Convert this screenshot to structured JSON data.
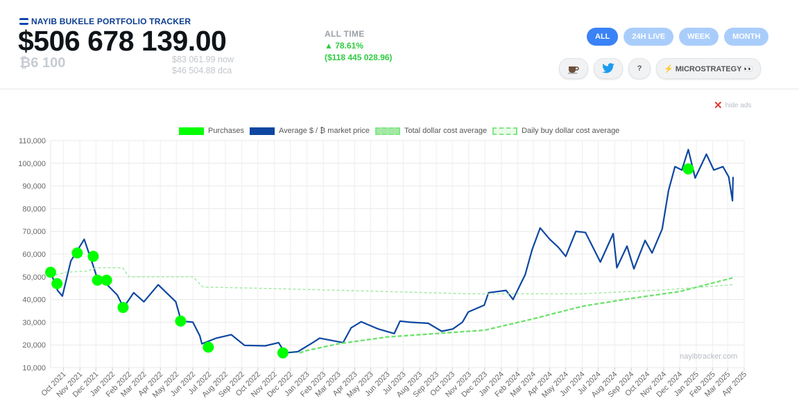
{
  "header": {
    "title": "NAYIB BUKELE PORTFOLIO TRACKER",
    "total_value": "$506 678 139.00",
    "btc_holdings": "₿6 100",
    "price_now": "$83 061.99",
    "price_now_suffix": "now",
    "price_dca": "$46 504.88",
    "price_dca_suffix": "dca",
    "all_time_label": "ALL TIME",
    "all_time_pct": "▲ 78.61%",
    "all_time_usd": "($118 445 028.96)"
  },
  "tabs": [
    {
      "label": "ALL",
      "active": true
    },
    {
      "label": "24H LIVE",
      "active": false
    },
    {
      "label": "WEEK",
      "active": false
    },
    {
      "label": "MONTH",
      "active": false
    }
  ],
  "buttons": {
    "coffee_icon": "coffee-icon",
    "twitter_icon": "twitter-icon",
    "help_label": "?",
    "microstrategy_label": "⚡ MICROSTRATEGY 👀"
  },
  "hide_ads": "hide ads",
  "watermark": "nayibtracker.com",
  "colors": {
    "accent": "#3b82f6",
    "accent_light": "#a9cdfb",
    "positive": "#2ecc40",
    "price_line": "#0d47a1",
    "purchases": "#00ff00",
    "dca_line": "#7ee787"
  },
  "chart_data": {
    "type": "line",
    "legend": [
      "Purchases",
      "Average $ / ₿ market price",
      "Total dollar cost average",
      "Daily buy dollar cost average"
    ],
    "legend_position": "top",
    "grid": true,
    "ylim": [
      10000,
      110000
    ],
    "y_ticks": [
      "10,000",
      "20,000",
      "30,000",
      "40,000",
      "50,000",
      "60,000",
      "70,000",
      "80,000",
      "90,000",
      "100,000",
      "110,000"
    ],
    "x_ticks": [
      "Oct 2021",
      "Nov 2021",
      "Dec 2021",
      "Jan 2022",
      "Feb 2022",
      "Mar 2022",
      "Apr 2022",
      "May 2022",
      "Jun 2022",
      "Jul 2022",
      "Aug 2022",
      "Sep 2022",
      "Oct 2022",
      "Nov 2022",
      "Dec 2022",
      "Jan 2023",
      "Feb 2023",
      "Mar 2023",
      "Apr 2023",
      "May 2023",
      "Jun 2023",
      "Jul 2023",
      "Aug 2023",
      "Sep 2023",
      "Oct 2023",
      "Nov 2023",
      "Dec 2023",
      "Jan 2024",
      "Feb 2024",
      "Mar 2024",
      "Apr 2024",
      "May 2024",
      "Jun 2024",
      "Jul 2024",
      "Aug 2024",
      "Sep 2024",
      "Oct 2024",
      "Nov 2024",
      "Dec 2024",
      "Jan 2025",
      "Feb 2025",
      "Mar 2025",
      "Apr 2025"
    ],
    "x_range": [
      "2021-09-07",
      "2025-04-01"
    ],
    "series": [
      {
        "name": "Average $ / ₿ market price",
        "x": [
          "2021-09-07",
          "2021-09-20",
          "2021-09-29",
          "2021-10-15",
          "2021-10-27",
          "2021-11-09",
          "2021-11-25",
          "2021-12-04",
          "2021-12-20",
          "2022-01-10",
          "2022-01-22",
          "2022-02-10",
          "2022-03-01",
          "2022-03-28",
          "2022-04-30",
          "2022-05-10",
          "2022-06-01",
          "2022-06-14",
          "2022-06-18",
          "2022-07-15",
          "2022-08-12",
          "2022-09-06",
          "2022-10-15",
          "2022-11-09",
          "2022-11-21",
          "2022-12-15",
          "2023-01-12",
          "2023-01-25",
          "2023-03-10",
          "2023-03-25",
          "2023-04-13",
          "2023-05-15",
          "2023-06-14",
          "2023-06-25",
          "2023-07-13",
          "2023-08-17",
          "2023-09-11",
          "2023-10-02",
          "2023-10-20",
          "2023-10-31",
          "2023-11-30",
          "2023-12-08",
          "2024-01-10",
          "2024-01-23",
          "2024-02-15",
          "2024-02-28",
          "2024-03-14",
          "2024-04-01",
          "2024-04-17",
          "2024-05-01",
          "2024-05-20",
          "2024-06-07",
          "2024-07-05",
          "2024-07-29",
          "2024-08-05",
          "2024-08-24",
          "2024-09-06",
          "2024-09-27",
          "2024-10-10",
          "2024-10-29",
          "2024-11-10",
          "2024-11-22",
          "2024-12-05",
          "2024-12-17",
          "2024-12-30",
          "2025-01-20",
          "2025-02-03",
          "2025-02-20",
          "2025-03-03",
          "2025-03-10",
          "2025-03-11"
        ],
        "y": [
          52000,
          44000,
          41500,
          57000,
          61500,
          66500,
          55500,
          49000,
          47000,
          42000,
          36500,
          43000,
          39000,
          46500,
          39000,
          30500,
          30000,
          24000,
          20500,
          23000,
          24500,
          19800,
          19600,
          21000,
          16500,
          17000,
          21000,
          23000,
          21000,
          27500,
          30200,
          27000,
          25000,
          30500,
          30000,
          29500,
          26000,
          27000,
          30000,
          34500,
          37500,
          43000,
          44000,
          40000,
          51000,
          62000,
          71500,
          66500,
          63000,
          59000,
          70000,
          69500,
          56500,
          69000,
          54000,
          63500,
          53500,
          66000,
          60500,
          71000,
          88000,
          98500,
          97000,
          106000,
          93500,
          104000,
          97000,
          98500,
          94000,
          83500,
          94000
        ]
      },
      {
        "name": "Total dollar cost average",
        "x": [
          "2022-12-18",
          "2023-01-01",
          "2023-03-01",
          "2023-06-01",
          "2023-09-01",
          "2023-12-01",
          "2024-03-01",
          "2024-06-01",
          "2024-09-01",
          "2024-12-01",
          "2025-03-10"
        ],
        "y": [
          16500,
          17500,
          20500,
          23500,
          25000,
          26500,
          31500,
          37000,
          40500,
          43500,
          49500
        ]
      },
      {
        "name": "Daily buy dollar cost average",
        "x": [
          "2021-09-07",
          "2021-09-20",
          "2021-10-05",
          "2021-11-15",
          "2021-12-01",
          "2022-01-20",
          "2022-02-01",
          "2022-06-01",
          "2022-06-20",
          "2022-11-01",
          "2023-06-01",
          "2023-11-01",
          "2024-06-01",
          "2024-11-01",
          "2025-03-10"
        ],
        "y": [
          51000,
          51000,
          52000,
          52500,
          54000,
          54000,
          50000,
          50000,
          45500,
          44800,
          43500,
          42500,
          42500,
          44200,
          46500
        ]
      }
    ],
    "purchases": {
      "name": "Purchases",
      "x": [
        "2021-09-07",
        "2021-09-19",
        "2021-10-27",
        "2021-11-26",
        "2021-12-04",
        "2021-12-21",
        "2022-01-21",
        "2022-05-09",
        "2022-06-30",
        "2022-11-17",
        "2024-12-17"
      ],
      "y": [
        52000,
        47000,
        60500,
        59000,
        48500,
        48500,
        36500,
        30500,
        19000,
        16500,
        97500
      ]
    }
  }
}
